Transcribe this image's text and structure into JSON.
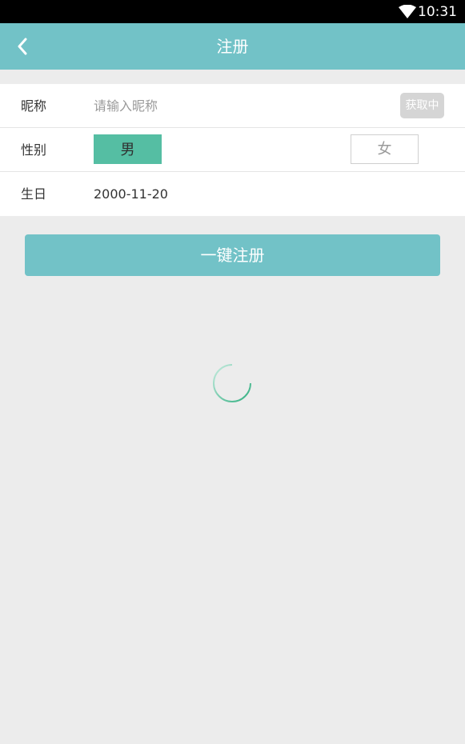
{
  "status_bar": {
    "time": "10:31",
    "icons": [
      "wifi-icon"
    ]
  },
  "app_bar": {
    "title": "注册",
    "back_icon": "chevron-left-icon"
  },
  "form": {
    "nickname": {
      "label": "昵称",
      "placeholder": "请输入昵称",
      "value": "",
      "fetch_button_label": "获取中"
    },
    "gender": {
      "label": "性别",
      "options": [
        "男",
        "女"
      ],
      "selected": "男"
    },
    "birthday": {
      "label": "生日",
      "value": "2000-11-20"
    }
  },
  "register_button_label": "一键注册",
  "colors": {
    "accent": "#72c2c7",
    "selected_gender": "#55bea3",
    "background": "#ececec",
    "disabled_button": "#d5d5d5"
  }
}
